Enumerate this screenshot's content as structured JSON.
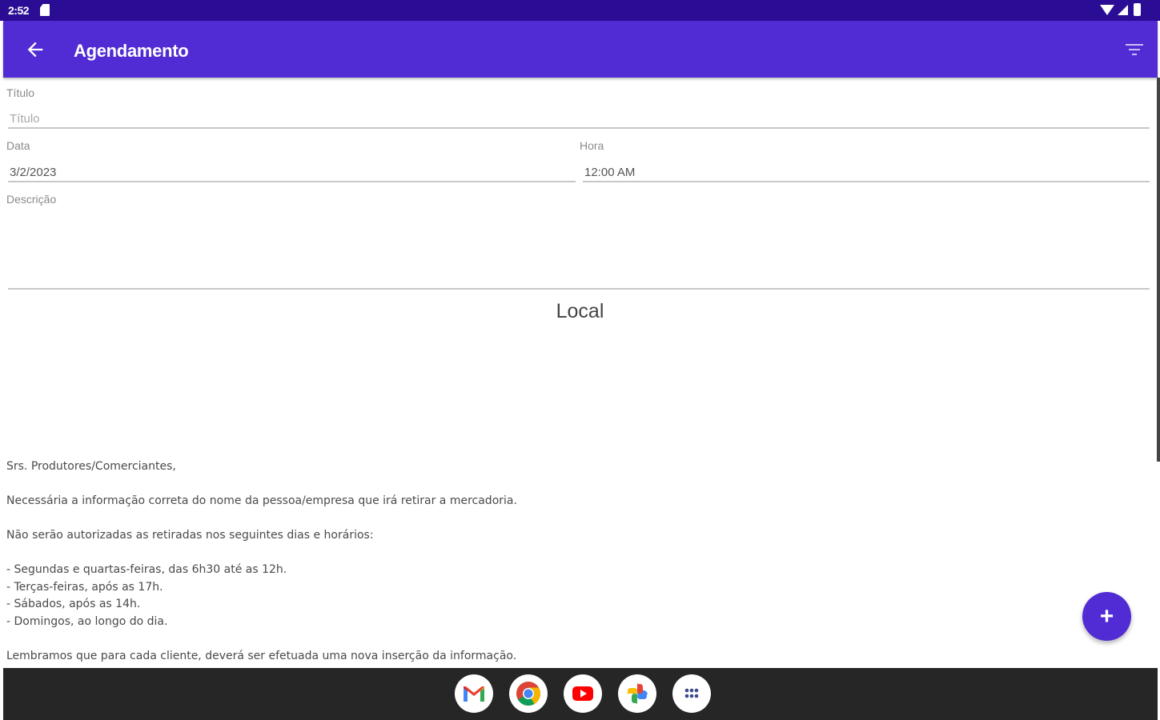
{
  "status_bar": {
    "time": "2:52"
  },
  "app_bar": {
    "title": "Agendamento",
    "color": "#512bd4"
  },
  "form": {
    "titulo_label": "Título",
    "titulo_placeholder": "Título",
    "data_label": "Data",
    "data_value": "3/2/2023",
    "hora_label": "Hora",
    "hora_value": "12:00 AM",
    "descricao_label": "Descrição"
  },
  "local": {
    "title": "Local"
  },
  "notice": {
    "greeting": "Srs. Produtores/Comerciantes,",
    "line1": "Necessária a informação correta do nome da pessoa/empresa que irá retirar a mercadoria.",
    "line2": "Não serão autorizadas as retiradas nos seguintes dias e horários:",
    "items": [
      "- Segundas e quartas-feiras, das 6h30 até as 12h.",
      "- Terças-feiras, após as 17h.",
      "- Sábados, após as 14h.",
      "- Domingos, ao longo do dia."
    ],
    "closing": "Lembramos que para cada cliente, deverá ser efetuada uma nova inserção da informação."
  },
  "fab": {
    "label": "+"
  },
  "taskbar": {
    "apps": [
      "gmail-icon",
      "chrome-icon",
      "youtube-icon",
      "photos-icon",
      "app-drawer-icon"
    ]
  }
}
